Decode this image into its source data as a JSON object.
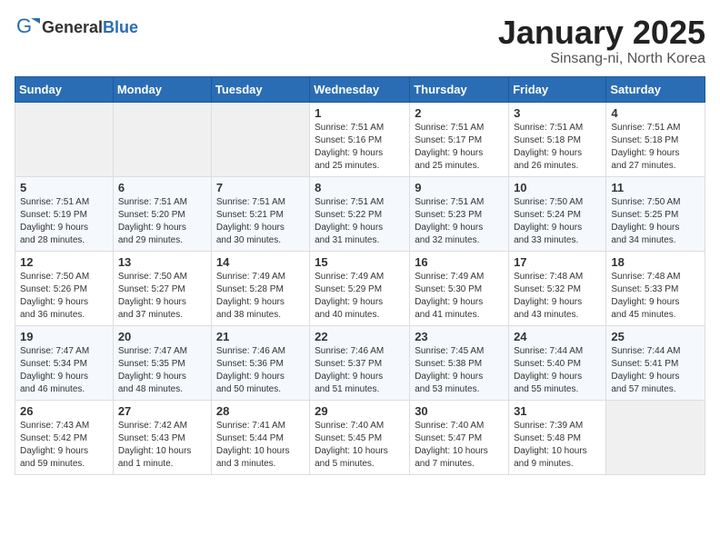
{
  "header": {
    "logo_general": "General",
    "logo_blue": "Blue",
    "month_title": "January 2025",
    "location": "Sinsang-ni, North Korea"
  },
  "weekdays": [
    "Sunday",
    "Monday",
    "Tuesday",
    "Wednesday",
    "Thursday",
    "Friday",
    "Saturday"
  ],
  "weeks": [
    [
      {
        "day": "",
        "info": ""
      },
      {
        "day": "",
        "info": ""
      },
      {
        "day": "",
        "info": ""
      },
      {
        "day": "1",
        "info": "Sunrise: 7:51 AM\nSunset: 5:16 PM\nDaylight: 9 hours\nand 25 minutes."
      },
      {
        "day": "2",
        "info": "Sunrise: 7:51 AM\nSunset: 5:17 PM\nDaylight: 9 hours\nand 25 minutes."
      },
      {
        "day": "3",
        "info": "Sunrise: 7:51 AM\nSunset: 5:18 PM\nDaylight: 9 hours\nand 26 minutes."
      },
      {
        "day": "4",
        "info": "Sunrise: 7:51 AM\nSunset: 5:18 PM\nDaylight: 9 hours\nand 27 minutes."
      }
    ],
    [
      {
        "day": "5",
        "info": "Sunrise: 7:51 AM\nSunset: 5:19 PM\nDaylight: 9 hours\nand 28 minutes."
      },
      {
        "day": "6",
        "info": "Sunrise: 7:51 AM\nSunset: 5:20 PM\nDaylight: 9 hours\nand 29 minutes."
      },
      {
        "day": "7",
        "info": "Sunrise: 7:51 AM\nSunset: 5:21 PM\nDaylight: 9 hours\nand 30 minutes."
      },
      {
        "day": "8",
        "info": "Sunrise: 7:51 AM\nSunset: 5:22 PM\nDaylight: 9 hours\nand 31 minutes."
      },
      {
        "day": "9",
        "info": "Sunrise: 7:51 AM\nSunset: 5:23 PM\nDaylight: 9 hours\nand 32 minutes."
      },
      {
        "day": "10",
        "info": "Sunrise: 7:50 AM\nSunset: 5:24 PM\nDaylight: 9 hours\nand 33 minutes."
      },
      {
        "day": "11",
        "info": "Sunrise: 7:50 AM\nSunset: 5:25 PM\nDaylight: 9 hours\nand 34 minutes."
      }
    ],
    [
      {
        "day": "12",
        "info": "Sunrise: 7:50 AM\nSunset: 5:26 PM\nDaylight: 9 hours\nand 36 minutes."
      },
      {
        "day": "13",
        "info": "Sunrise: 7:50 AM\nSunset: 5:27 PM\nDaylight: 9 hours\nand 37 minutes."
      },
      {
        "day": "14",
        "info": "Sunrise: 7:49 AM\nSunset: 5:28 PM\nDaylight: 9 hours\nand 38 minutes."
      },
      {
        "day": "15",
        "info": "Sunrise: 7:49 AM\nSunset: 5:29 PM\nDaylight: 9 hours\nand 40 minutes."
      },
      {
        "day": "16",
        "info": "Sunrise: 7:49 AM\nSunset: 5:30 PM\nDaylight: 9 hours\nand 41 minutes."
      },
      {
        "day": "17",
        "info": "Sunrise: 7:48 AM\nSunset: 5:32 PM\nDaylight: 9 hours\nand 43 minutes."
      },
      {
        "day": "18",
        "info": "Sunrise: 7:48 AM\nSunset: 5:33 PM\nDaylight: 9 hours\nand 45 minutes."
      }
    ],
    [
      {
        "day": "19",
        "info": "Sunrise: 7:47 AM\nSunset: 5:34 PM\nDaylight: 9 hours\nand 46 minutes."
      },
      {
        "day": "20",
        "info": "Sunrise: 7:47 AM\nSunset: 5:35 PM\nDaylight: 9 hours\nand 48 minutes."
      },
      {
        "day": "21",
        "info": "Sunrise: 7:46 AM\nSunset: 5:36 PM\nDaylight: 9 hours\nand 50 minutes."
      },
      {
        "day": "22",
        "info": "Sunrise: 7:46 AM\nSunset: 5:37 PM\nDaylight: 9 hours\nand 51 minutes."
      },
      {
        "day": "23",
        "info": "Sunrise: 7:45 AM\nSunset: 5:38 PM\nDaylight: 9 hours\nand 53 minutes."
      },
      {
        "day": "24",
        "info": "Sunrise: 7:44 AM\nSunset: 5:40 PM\nDaylight: 9 hours\nand 55 minutes."
      },
      {
        "day": "25",
        "info": "Sunrise: 7:44 AM\nSunset: 5:41 PM\nDaylight: 9 hours\nand 57 minutes."
      }
    ],
    [
      {
        "day": "26",
        "info": "Sunrise: 7:43 AM\nSunset: 5:42 PM\nDaylight: 9 hours\nand 59 minutes."
      },
      {
        "day": "27",
        "info": "Sunrise: 7:42 AM\nSunset: 5:43 PM\nDaylight: 10 hours\nand 1 minute."
      },
      {
        "day": "28",
        "info": "Sunrise: 7:41 AM\nSunset: 5:44 PM\nDaylight: 10 hours\nand 3 minutes."
      },
      {
        "day": "29",
        "info": "Sunrise: 7:40 AM\nSunset: 5:45 PM\nDaylight: 10 hours\nand 5 minutes."
      },
      {
        "day": "30",
        "info": "Sunrise: 7:40 AM\nSunset: 5:47 PM\nDaylight: 10 hours\nand 7 minutes."
      },
      {
        "day": "31",
        "info": "Sunrise: 7:39 AM\nSunset: 5:48 PM\nDaylight: 10 hours\nand 9 minutes."
      },
      {
        "day": "",
        "info": ""
      }
    ]
  ]
}
